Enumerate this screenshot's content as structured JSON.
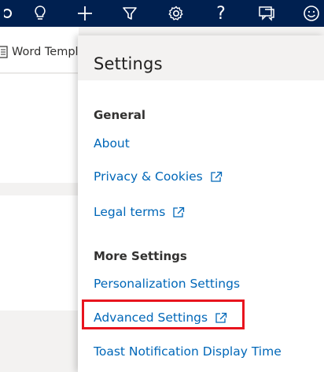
{
  "topbar": {
    "icons": [
      "lightbulb-icon",
      "plus-icon",
      "filter-icon",
      "gear-icon",
      "help-icon",
      "feedback-icon",
      "smiley-icon"
    ],
    "help_glyph": "?",
    "background_color": "#002050"
  },
  "background": {
    "toolbar_label": "Word Templates"
  },
  "settings_panel": {
    "title": "Settings",
    "sections": [
      {
        "heading": "General",
        "links": [
          {
            "label": "About",
            "external": false
          },
          {
            "label": "Privacy & Cookies",
            "external": true
          },
          {
            "label": "Legal terms",
            "external": true
          }
        ]
      },
      {
        "heading": "More Settings",
        "links": [
          {
            "label": "Personalization Settings",
            "external": false
          },
          {
            "label": "Advanced Settings",
            "external": true,
            "highlighted": true
          },
          {
            "label": "Toast Notification Display Time",
            "external": false
          }
        ]
      }
    ],
    "link_color": "#0067b8",
    "highlight_color": "#e8141e"
  }
}
